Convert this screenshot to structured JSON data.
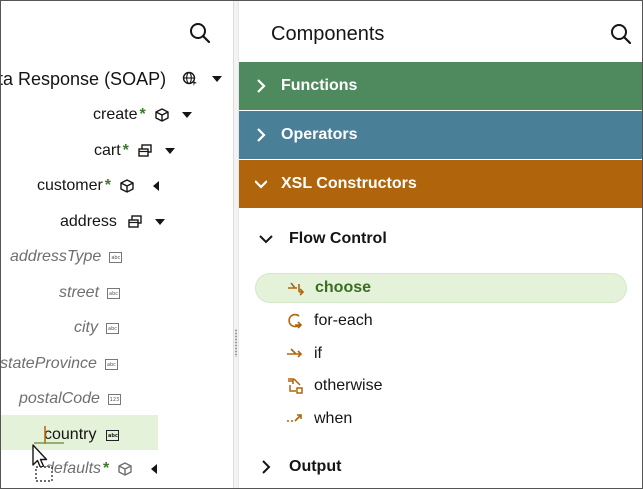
{
  "left_panel": {
    "search_icon": "search-icon",
    "root": {
      "label": "ta Response (SOAP)",
      "icon": "globe-icon"
    },
    "nodes": [
      {
        "label": "create",
        "required": "*",
        "icon": "cube-icon"
      },
      {
        "label": "cart",
        "required": "*",
        "icon": "stacked-windows-icon"
      },
      {
        "label": "customer",
        "required": "*",
        "icon": "cube-icon"
      },
      {
        "label": "address",
        "required": "",
        "icon": "stacked-windows-icon"
      }
    ],
    "attributes": [
      {
        "label": "addressType",
        "type_icon": "abc"
      },
      {
        "label": "street",
        "type_icon": "abc"
      },
      {
        "label": "city",
        "type_icon": "abc"
      },
      {
        "label": "stateProvince",
        "type_icon": "abc"
      },
      {
        "label": "postalCode",
        "type_icon": "123"
      }
    ],
    "selected": {
      "label": "country",
      "type_icon": "abc"
    },
    "last": {
      "label": "defaults",
      "required": "*",
      "icon": "cube-icon"
    }
  },
  "right_panel": {
    "title": "Components",
    "search_icon": "search-icon",
    "categories": [
      {
        "label": "Functions",
        "color": "#4f8a5e",
        "expanded": false
      },
      {
        "label": "Operators",
        "color": "#4a7f98",
        "expanded": false
      },
      {
        "label": "XSL Constructors",
        "color": "#b0650d",
        "expanded": true
      }
    ],
    "sections": [
      {
        "label": "Flow Control",
        "expanded": true
      },
      {
        "label": "Output",
        "expanded": false
      }
    ],
    "flow_items": [
      {
        "label": "choose",
        "icon": "choose-icon",
        "selected": true
      },
      {
        "label": "for-each",
        "icon": "loop-icon",
        "selected": false
      },
      {
        "label": "if",
        "icon": "branch-icon",
        "selected": false
      },
      {
        "label": "otherwise",
        "icon": "otherwise-icon",
        "selected": false
      },
      {
        "label": "when",
        "icon": "when-icon",
        "selected": false
      }
    ]
  },
  "colors": {
    "accent_orange": "#b0650d",
    "selected_bg": "#e4f2d9",
    "required_green": "#3a7a2a"
  }
}
